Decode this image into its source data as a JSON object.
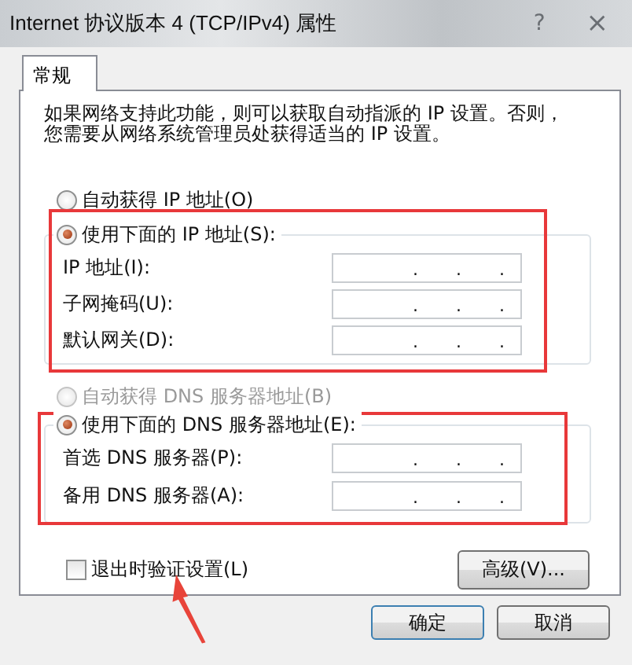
{
  "window": {
    "title": "Internet 协议版本 4 (TCP/IPv4) 属性",
    "help_button": "?",
    "close_button": "×"
  },
  "tabs": [
    {
      "label": "常规",
      "selected": true
    }
  ],
  "description_lines": [
    "如果网络支持此功能，则可以获取自动指派的 IP 设置。否则，",
    "您需要从网络系统管理员处获得适当的 IP 设置。"
  ],
  "ip_settings": {
    "highlighted": true,
    "auto_option": {
      "label": "自动获得 IP 地址(O)",
      "selected": false,
      "disabled": false
    },
    "manual_option": {
      "label": "使用下面的 IP 地址(S):",
      "selected": true,
      "disabled": false
    },
    "fields": [
      {
        "label": "IP 地址(I):",
        "separators": [
          ".",
          ".",
          "."
        ]
      },
      {
        "label": "子网掩码(U):",
        "separators": [
          ".",
          ".",
          "."
        ]
      },
      {
        "label": "默认网关(D):",
        "separators": [
          ".",
          ".",
          "."
        ]
      }
    ]
  },
  "dns_settings": {
    "highlighted": true,
    "auto_option": {
      "label": "自动获得 DNS 服务器地址(B)",
      "selected": false,
      "disabled": true
    },
    "manual_option": {
      "label": "使用下面的 DNS 服务器地址(E):",
      "selected": true,
      "disabled": false
    },
    "fields": [
      {
        "label": "首选 DNS 服务器(P):",
        "separators": [
          ".",
          ".",
          "."
        ]
      },
      {
        "label": "备用 DNS 服务器(A):",
        "separators": [
          ".",
          ".",
          "."
        ]
      }
    ]
  },
  "validate_checkbox": {
    "label": "退出时验证设置(L)",
    "checked": false
  },
  "advanced_button": "高级(V)...",
  "buttons": [
    "确定",
    "取消"
  ],
  "pointer_arrow": true
}
